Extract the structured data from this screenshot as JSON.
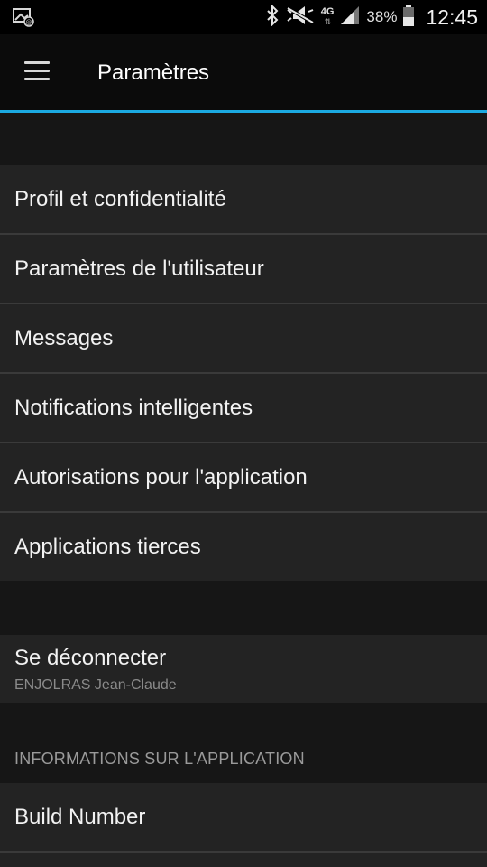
{
  "status_bar": {
    "network_type": "4G",
    "network_arrows": "⇅",
    "battery_percent": "38%",
    "time": "12:45",
    "icons": [
      "screenshot-notification-icon",
      "bluetooth-icon",
      "mute-icon",
      "signal-icon",
      "battery-icon"
    ]
  },
  "app_bar": {
    "title": "Paramètres",
    "accent_color": "#1ba9e1"
  },
  "settings": {
    "group1": [
      "Profil et confidentialité",
      "Paramètres de l'utilisateur",
      "Messages",
      "Notifications intelligentes",
      "Autorisations pour l'application",
      "Applications tierces"
    ],
    "logout": {
      "label": "Se déconnecter",
      "account": "ENJOLRAS Jean-Claude"
    },
    "app_info": {
      "header": "INFORMATIONS SUR L'APPLICATION",
      "build_label": "Build Number"
    }
  }
}
